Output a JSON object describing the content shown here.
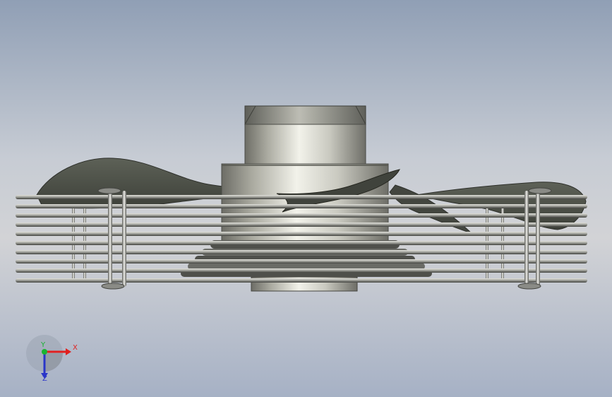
{
  "viewport": {
    "background_top": "#909fb5",
    "background_middle": "#d2d3d6",
    "background_bottom": "#a6b1c5"
  },
  "model": {
    "icon": "axial-fan-with-guard",
    "metal_color": "#c8c8c0",
    "blade_color": "#4e5248",
    "wire_color": "#7d7f78"
  },
  "triad": {
    "x_label": "X",
    "y_label": "Y",
    "z_label": "Z",
    "x_color": "#e0201f",
    "y_color": "#19b431",
    "z_color": "#2a35c8"
  }
}
